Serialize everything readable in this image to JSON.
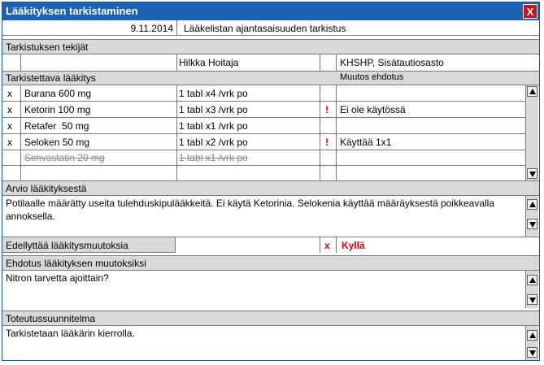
{
  "window": {
    "title": "Lääkityksen tarkistaminen",
    "close_label": "X"
  },
  "header": {
    "date": "9.11.2014",
    "type": "Lääkelistan ajantasaisuuden tarkistus"
  },
  "reviewers": {
    "label": "Tarkistuksen tekijät",
    "name": "Hilkka Hoitaja",
    "unit": "KHSHP, Sisätautiosasto"
  },
  "medication": {
    "label": "Tarkistettava lääkitys",
    "suggestion_label": "Muutos ehdotus",
    "rows": [
      {
        "mark": "x",
        "drug": "Burana 600 mg",
        "dose": "1 tabl x4 /vrk po",
        "flag": "",
        "suggestion": "",
        "struck": false
      },
      {
        "mark": "x",
        "drug": "Ketorin 100 mg",
        "dose": "1 tabl x3 /vrk po",
        "flag": "!",
        "suggestion": "Ei ole käytössä",
        "struck": false
      },
      {
        "mark": "x",
        "drug": "Retafer  50 mg",
        "dose": "1 tabl x1 /vrk po",
        "flag": "",
        "suggestion": "",
        "struck": false
      },
      {
        "mark": "x",
        "drug": "Seloken 50 mg",
        "dose": "1 tabl x2 /vrk po",
        "flag": "!",
        "suggestion": "Käyttää 1x1",
        "struck": false
      },
      {
        "mark": "",
        "drug": "Simvastatin 20 mg",
        "dose": "1 tabl x1 /vrk po",
        "flag": "",
        "suggestion": "",
        "struck": true
      },
      {
        "mark": "",
        "drug": "",
        "dose": "",
        "flag": "",
        "suggestion": "",
        "struck": false
      }
    ]
  },
  "assessment": {
    "label": "Arvio lääkityksestä",
    "text": "Potilaalle määrätty useita tulehduskipulääkkeitä. Ei käytä Ketorinia. Selokenia käyttää määräyksestä poikkeavalla annoksella."
  },
  "requires_change": {
    "label": "Edellyttää lääkitysmuutoksia",
    "mark": "x",
    "value": "Kyllä"
  },
  "proposal": {
    "label": "Ehdotus lääkityksen muutoksiksi",
    "text": "Nitron tarvetta ajoittain?"
  },
  "plan": {
    "label": "Toteutussuunnitelma",
    "text": "Tarkistetaan lääkärin kierrolla."
  },
  "colors": {
    "titlebar": "#1d63b3",
    "close": "#c0161c",
    "band": "#d9d9d9",
    "alert": "#e00000"
  },
  "icons": {
    "close": "close-icon",
    "scroll_up": "triangle-up-icon",
    "scroll_down": "triangle-down-icon"
  }
}
